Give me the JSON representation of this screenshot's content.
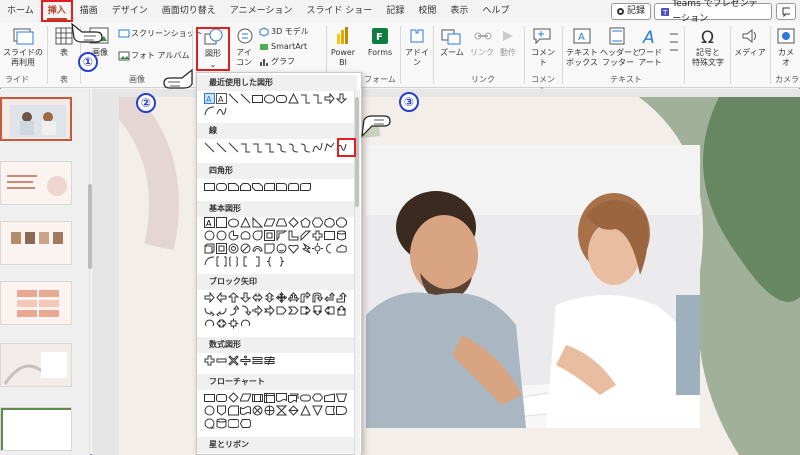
{
  "tabs": [
    {
      "label": "ホーム",
      "state": "normal"
    },
    {
      "label": "挿入",
      "state": "active"
    },
    {
      "label": "描画",
      "state": "normal"
    },
    {
      "label": "デザイン",
      "state": "normal"
    },
    {
      "label": "画面切り替え",
      "state": "normal"
    },
    {
      "label": "アニメーション",
      "state": "normal"
    },
    {
      "label": "スライド ショー",
      "state": "normal"
    },
    {
      "label": "記録",
      "state": "normal"
    },
    {
      "label": "校閲",
      "state": "normal"
    },
    {
      "label": "表示",
      "state": "normal"
    },
    {
      "label": "ヘルプ",
      "state": "normal"
    }
  ],
  "header_buttons": {
    "record": "記録",
    "teams": "Teams でプレゼンテーション"
  },
  "ribbon": {
    "slide_reuse": "スライドの\n再利用",
    "group_slide": "ライド",
    "table": "表",
    "group_table": "表",
    "image": "画像",
    "screenshot": "スクリーンショット",
    "photo_album": "フォト アルバム",
    "group_image": "画像",
    "shapes": "図形",
    "icons": "アイ\nコン",
    "model3d": "3D モデル",
    "smartart": "SmartArt",
    "graph": "グラフ",
    "powerbi": "Power\nBI",
    "forms": "Forms",
    "group_forms": "フォーム",
    "addins": "アドイ\nン",
    "zoom": "ズーム",
    "link": "リンク",
    "action": "動作",
    "group_link": "リンク",
    "comment": "コメント",
    "group_comment": "コメント",
    "textbox": "テキスト\nボックス",
    "header_footer": "ヘッダーと\nフッター",
    "wordart": "ワード\nアート",
    "group_text": "テキスト",
    "symbols": "記号と\n特殊文字",
    "media": "メディア",
    "camera": "カメ\nオ",
    "group_camera": "カメラ"
  },
  "dropdown": {
    "sections": [
      {
        "title": "最近使用した図形"
      },
      {
        "title": "線"
      },
      {
        "title": "四角形"
      },
      {
        "title": "基本図形"
      },
      {
        "title": "ブロック矢印"
      },
      {
        "title": "数式図形"
      },
      {
        "title": "フローチャート"
      },
      {
        "title": "星とリボン"
      }
    ]
  },
  "annotations": {
    "step1": "①",
    "step2": "②",
    "step3": "③"
  },
  "colors": {
    "accent": "#b7472a",
    "highlight_red": "#e02020",
    "annotation_blue": "#2a3fc9"
  }
}
